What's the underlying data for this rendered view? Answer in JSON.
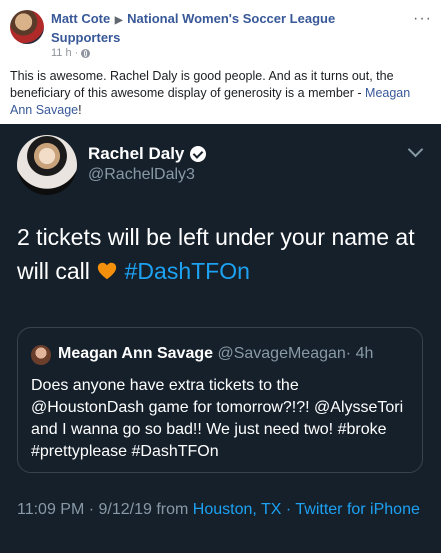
{
  "facebook_post": {
    "poster_name": "Matt Cote",
    "group_name": "National Women's Soccer League Supporters",
    "time": "11 h",
    "body_text_1": "This is awesome. Rachel Daly is good people. And as it turns out, the beneficiary of this awesome display of generosity is a member - ",
    "mention": "Meagan Ann Savage",
    "body_text_2": "!"
  },
  "tweet": {
    "name": "Rachel Daly",
    "handle": "@RachelDaly3",
    "text": "2 tickets will be left under your name at will call",
    "hashtag": "#DashTFOn",
    "quoted": {
      "name": "Meagan Ann Savage",
      "handle": "@SavageMeagan",
      "time": "· 4h",
      "text": "Does anyone have extra tickets to the @HoustonDash game for tomorrow?!?! @AlysseTori  and I wanna go so bad!! We just need two! #broke #prettyplease #DashTFOn"
    },
    "timestamp": "11:09 PM · 9/12/19 from",
    "location": "Houston, TX",
    "source": "· Twitter for iPhone"
  },
  "colors": {
    "fb_link": "#385898",
    "tweet_bg": "#15202b",
    "twitter_blue": "#1da1f2",
    "muted": "#8899a6"
  },
  "icons": [
    "avatar",
    "play-arrow-icon",
    "globe-icon",
    "more-dots-icon",
    "verified-badge-icon",
    "chevron-down-icon",
    "orange-heart-emoji-icon"
  ]
}
